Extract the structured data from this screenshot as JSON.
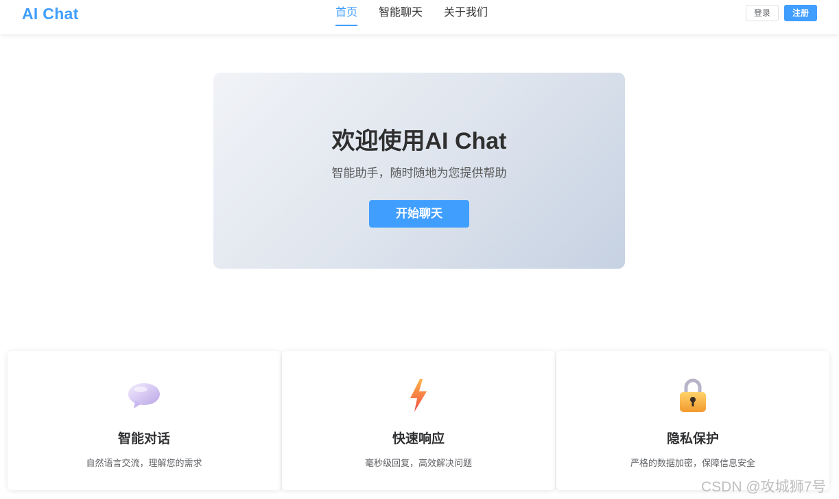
{
  "header": {
    "logo": "AI Chat",
    "nav": [
      {
        "label": "首页",
        "active": true
      },
      {
        "label": "智能聊天",
        "active": false
      },
      {
        "label": "关于我们",
        "active": false
      }
    ],
    "login_label": "登录",
    "register_label": "注册"
  },
  "hero": {
    "title": "欢迎使用AI Chat",
    "subtitle": "智能助手，随时随地为您提供帮助",
    "button_label": "开始聊天"
  },
  "features": [
    {
      "icon": "speech-bubble-icon",
      "title": "智能对话",
      "desc": "自然语言交流，理解您的需求"
    },
    {
      "icon": "lightning-icon",
      "title": "快速响应",
      "desc": "毫秒级回复，高效解决问题"
    },
    {
      "icon": "lock-icon",
      "title": "隐私保护",
      "desc": "严格的数据加密，保障信息安全"
    }
  ],
  "watermark": "CSDN @攻城狮7号",
  "colors": {
    "accent": "#409eff",
    "text": "#303133",
    "muted": "#606266"
  }
}
